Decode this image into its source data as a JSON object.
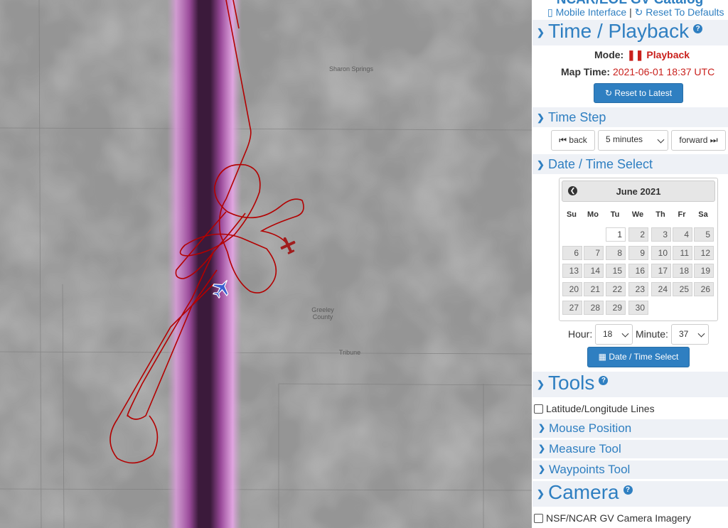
{
  "app": {
    "title": "NCAR/EOL GV Catalog"
  },
  "top_links": {
    "mobile": "Mobile Interface",
    "separator": "|",
    "reset": "Reset To Defaults"
  },
  "time_playback": {
    "title": "Time / Playback",
    "mode_label": "Mode:",
    "mode_value": "Playback",
    "map_time_label": "Map Time:",
    "map_time_value": "2021-06-01 18:37 UTC",
    "reset_button": "Reset to Latest"
  },
  "time_step": {
    "title": "Time Step",
    "back": "back",
    "step_value": "5 minutes",
    "forward": "forward"
  },
  "date_select": {
    "title": "Date / Time Select",
    "month": "June 2021",
    "dows": [
      "Su",
      "Mo",
      "Tu",
      "We",
      "Th",
      "Fr",
      "Sa"
    ],
    "weeks": [
      [
        "",
        "",
        "1",
        "2",
        "3",
        "4",
        "5"
      ],
      [
        "6",
        "7",
        "8",
        "9",
        "10",
        "11",
        "12"
      ],
      [
        "13",
        "14",
        "15",
        "16",
        "17",
        "18",
        "19"
      ],
      [
        "20",
        "21",
        "22",
        "23",
        "24",
        "25",
        "26"
      ],
      [
        "27",
        "28",
        "29",
        "30",
        "",
        "",
        ""
      ]
    ],
    "active_day": "1",
    "hour_label": "Hour:",
    "hour_value": "18",
    "minute_label": "Minute:",
    "minute_value": "37",
    "button": "Date / Time Select"
  },
  "tools": {
    "title": "Tools",
    "latlon": "Latitude/Longitude Lines",
    "mouse_position": "Mouse Position",
    "measure": "Measure Tool",
    "waypoints": "Waypoints Tool"
  },
  "camera": {
    "title": "Camera",
    "imagery": "NSF/NCAR GV Camera Imagery"
  },
  "map": {
    "labels": {
      "sharon_springs": "Sharon Springs",
      "greeley": "Greeley",
      "county": "County",
      "tribune": "Tribune"
    },
    "track_color": "#b30000",
    "aircraft_color": "#3a5fd0"
  }
}
